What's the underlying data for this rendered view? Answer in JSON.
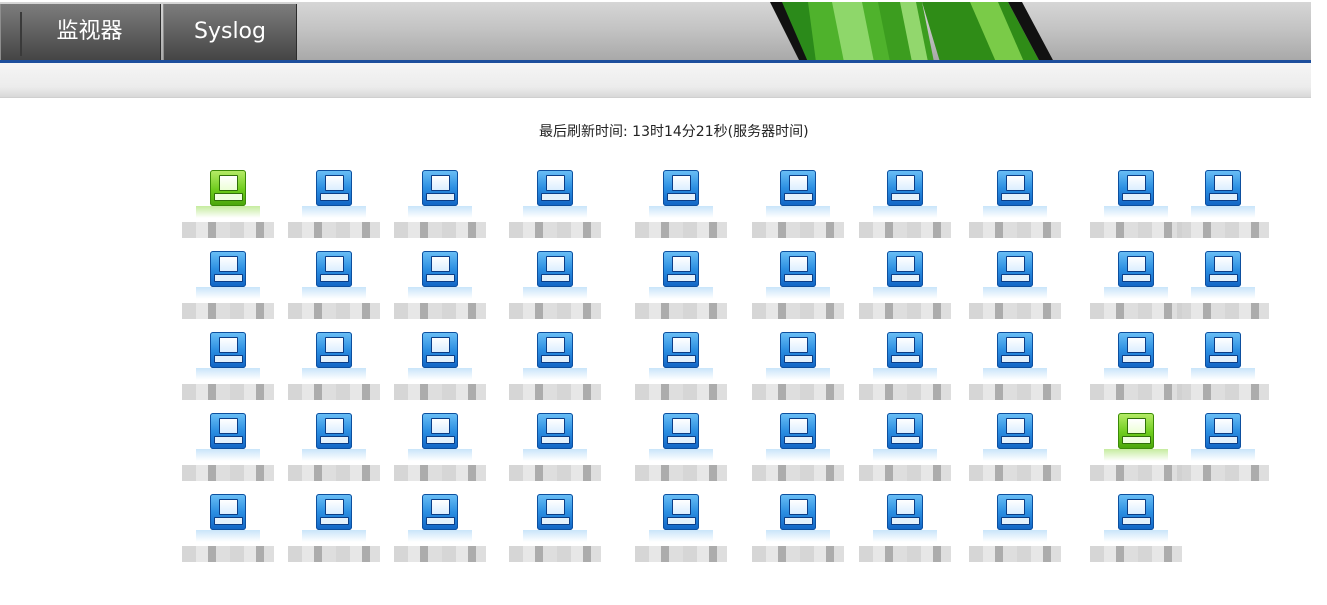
{
  "tabs": [
    {
      "label": "监视器"
    },
    {
      "label": "Syslog"
    }
  ],
  "refresh_text": "最后刷新时间: 13时14分21秒(服务器时间)",
  "colors": {
    "tab_bg": "#5e5e5e",
    "accent_line": "#1d4e9c",
    "device_online": "#2c8fe2",
    "device_alert": "#6dcc1c"
  },
  "devices": [
    {
      "status": "green"
    },
    {
      "status": "blue"
    },
    {
      "status": "blue"
    },
    {
      "status": "blue"
    },
    {
      "status": "blue"
    },
    {
      "status": "blue"
    },
    {
      "status": "blue"
    },
    {
      "status": "blue"
    },
    {
      "status": "blue"
    },
    {
      "status": "blue"
    },
    {
      "status": "blue"
    },
    {
      "status": "blue"
    },
    {
      "status": "blue"
    },
    {
      "status": "blue"
    },
    {
      "status": "blue"
    },
    {
      "status": "blue"
    },
    {
      "status": "blue"
    },
    {
      "status": "blue"
    },
    {
      "status": "blue"
    },
    {
      "status": "blue"
    },
    {
      "status": "blue"
    },
    {
      "status": "blue"
    },
    {
      "status": "blue"
    },
    {
      "status": "blue"
    },
    {
      "status": "blue"
    },
    {
      "status": "blue"
    },
    {
      "status": "blue"
    },
    {
      "status": "blue"
    },
    {
      "status": "blue"
    },
    {
      "status": "blue"
    },
    {
      "status": "blue"
    },
    {
      "status": "blue"
    },
    {
      "status": "blue"
    },
    {
      "status": "blue"
    },
    {
      "status": "blue"
    },
    {
      "status": "blue"
    },
    {
      "status": "blue"
    },
    {
      "status": "blue"
    },
    {
      "status": "green"
    },
    {
      "status": "blue"
    },
    {
      "status": "blue"
    },
    {
      "status": "blue"
    },
    {
      "status": "blue"
    },
    {
      "status": "blue"
    },
    {
      "status": "blue"
    },
    {
      "status": "blue"
    },
    {
      "status": "blue"
    },
    {
      "status": "blue"
    },
    {
      "status": "blue"
    }
  ]
}
